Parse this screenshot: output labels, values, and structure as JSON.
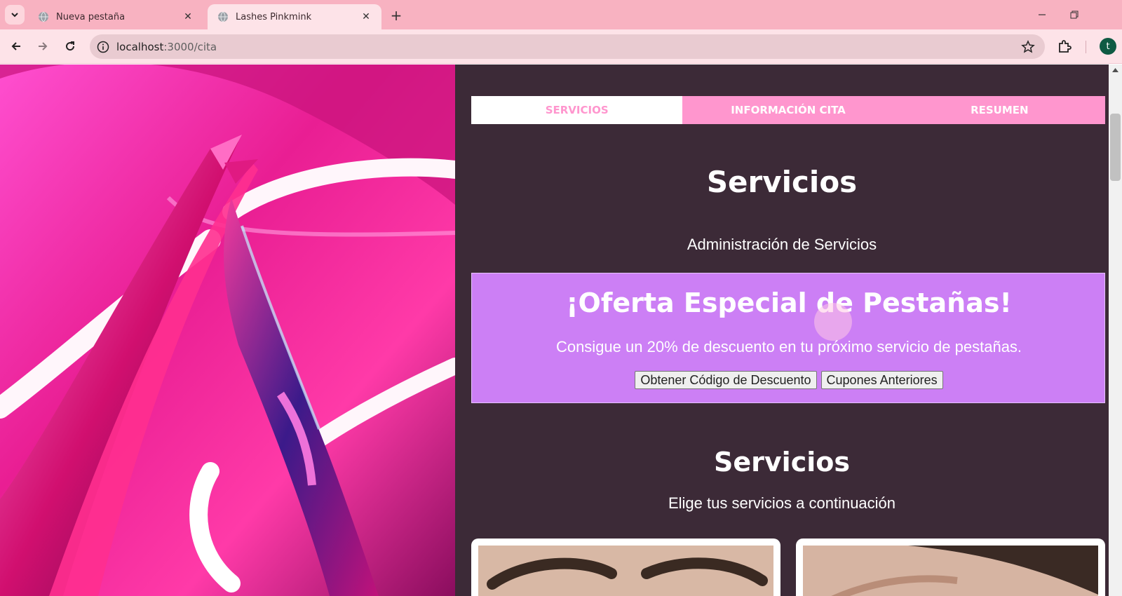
{
  "browser": {
    "tabs": [
      {
        "title": "Nueva pestaña",
        "active": false
      },
      {
        "title": "Lashes Pinkmink",
        "active": true
      }
    ],
    "url_host": "localhost",
    "url_path": ":3000/cita",
    "profile_initial": "t"
  },
  "steps": [
    {
      "label": "SERVICIOS",
      "active": true
    },
    {
      "label": "INFORMACIÓN CITA",
      "active": false
    },
    {
      "label": "RESUMEN",
      "active": false
    }
  ],
  "admin_section": {
    "title": "Servicios",
    "subtitle": "Administración de Servicios"
  },
  "offer": {
    "title": "¡Oferta Especial de Pestañas!",
    "text": "Consigue un 20% de descuento en tu próximo servicio de pestañas.",
    "buttons": [
      "Obtener Código de Descuento",
      "Cupones Anteriores"
    ]
  },
  "services_section": {
    "title": "Servicios",
    "subtitle": "Elige tus servicios a continuación"
  },
  "colors": {
    "tabbar": "#f8b2c1",
    "toolbar": "#fde3e8",
    "content_bg": "#3c2a37",
    "accent_pink": "#ff96ce",
    "offer_bg": "#cc7ff5"
  },
  "icons": {
    "hero": "neon-tweezers-image",
    "card_1": "eyebrows-photo",
    "card_2": "eyelash-photo"
  }
}
